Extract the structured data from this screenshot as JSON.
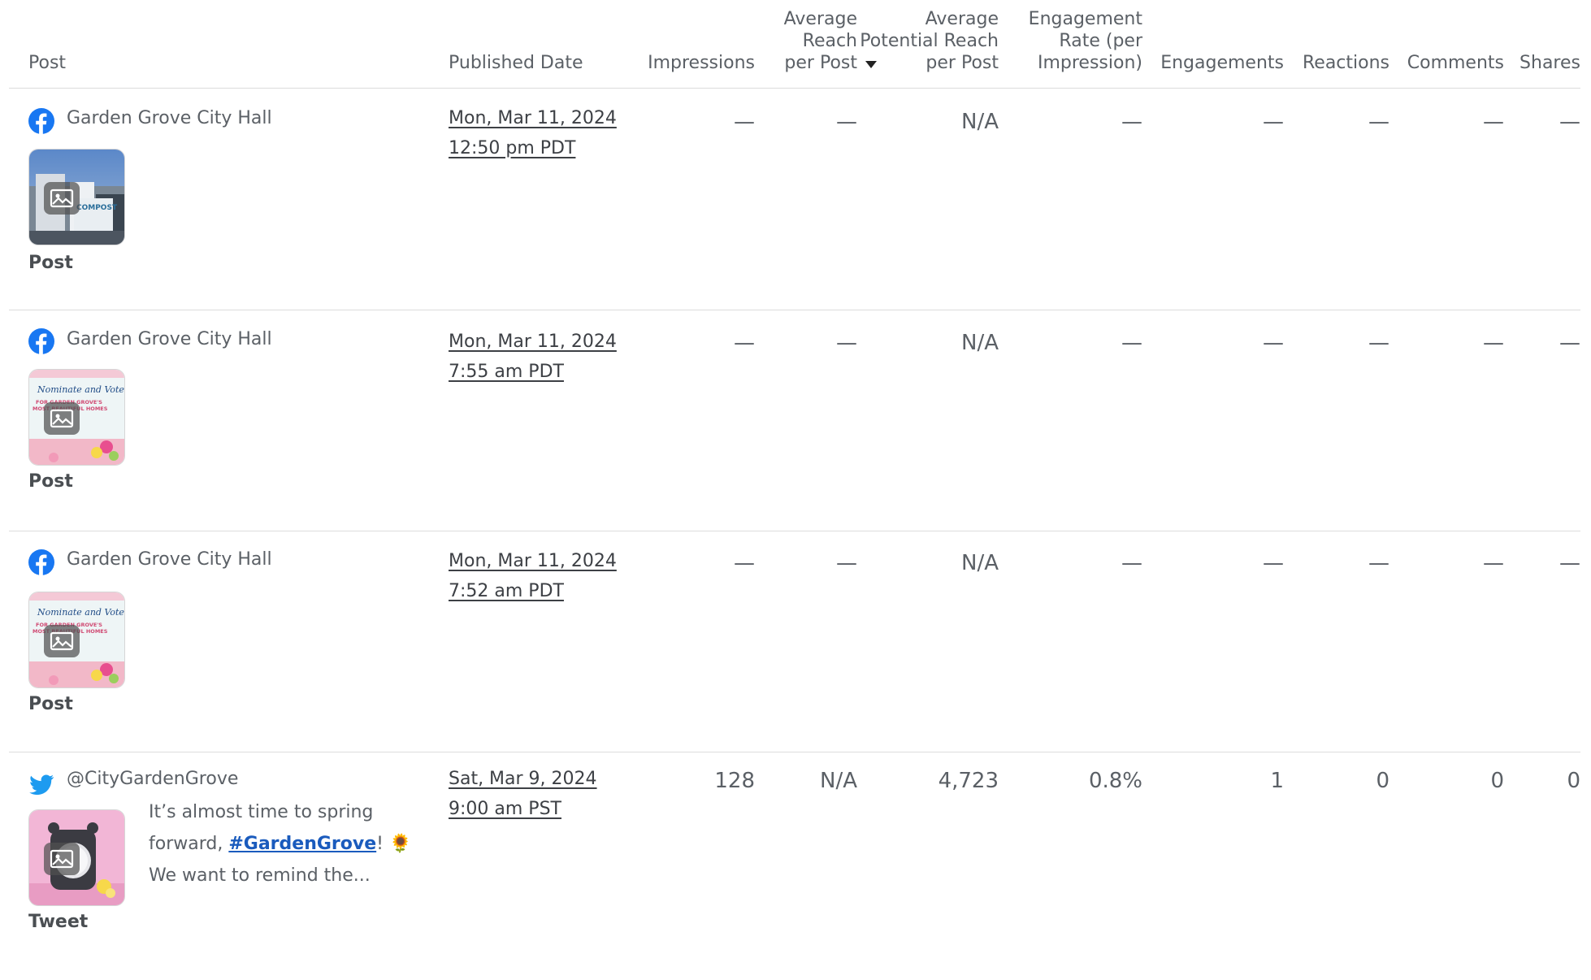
{
  "header": {
    "post": "Post",
    "published_date": "Published Date",
    "impressions": "Impressions",
    "avg_reach": [
      "Average",
      "Reach",
      "per Post"
    ],
    "avg_potential_reach": [
      "Average",
      "Potential Reach",
      "per Post"
    ],
    "engagement_rate": [
      "Engagement",
      "Rate (per",
      "Impression)"
    ],
    "engagements": "Engagements",
    "reactions": "Reactions",
    "comments": "Comments",
    "shares": "Shares"
  },
  "rows": [
    {
      "network": "facebook-icon",
      "account": "Garden Grove City Hall",
      "type": "Post",
      "date_line1": "Mon, Mar 11, 2024",
      "date_line2": "12:50 pm PDT",
      "impressions": "—",
      "avg_reach": "—",
      "avg_potential_reach": "N/A",
      "engagement_rate": "—",
      "engagements": "—",
      "reactions": "—",
      "comments": "—",
      "shares": "—"
    },
    {
      "network": "facebook-icon",
      "account": "Garden Grove City Hall",
      "type": "Post",
      "date_line1": "Mon, Mar 11, 2024",
      "date_line2": "7:55 am PDT",
      "impressions": "—",
      "avg_reach": "—",
      "avg_potential_reach": "N/A",
      "engagement_rate": "—",
      "engagements": "—",
      "reactions": "—",
      "comments": "—",
      "shares": "—"
    },
    {
      "network": "facebook-icon",
      "account": "Garden Grove City Hall",
      "type": "Post",
      "date_line1": "Mon, Mar 11, 2024",
      "date_line2": "7:52 am PDT",
      "impressions": "—",
      "avg_reach": "—",
      "avg_potential_reach": "N/A",
      "engagement_rate": "—",
      "engagements": "—",
      "reactions": "—",
      "comments": "—",
      "shares": "—"
    },
    {
      "network": "twitter-icon",
      "account": "@CityGardenGrove",
      "type": "Tweet",
      "date_line1": "Sat, Mar 9, 2024",
      "date_line2": "9:00 am PST",
      "text_before": "It’s almost time to spring forward, ",
      "hashtag": "#GardenGrove",
      "text_after": "! 🌻 We want to remind the...",
      "impressions": "128",
      "avg_reach": "N/A",
      "avg_potential_reach": "4,723",
      "engagement_rate": "0.8%",
      "engagements": "1",
      "reactions": "0",
      "comments": "0",
      "shares": "0"
    }
  ],
  "thumb_labels": {
    "nominate_line1": "Nominate and Vote",
    "nominate_line2": "FOR GARDEN GROVE'S",
    "nominate_line3": "MOST BEAUTIFUL HOMES",
    "compost": "COMPOST"
  },
  "colors": {
    "facebook": "#1877f2",
    "twitter": "#1d9bf0",
    "hashtag": "#1a5bbd",
    "divider": "#dcdcdc"
  }
}
